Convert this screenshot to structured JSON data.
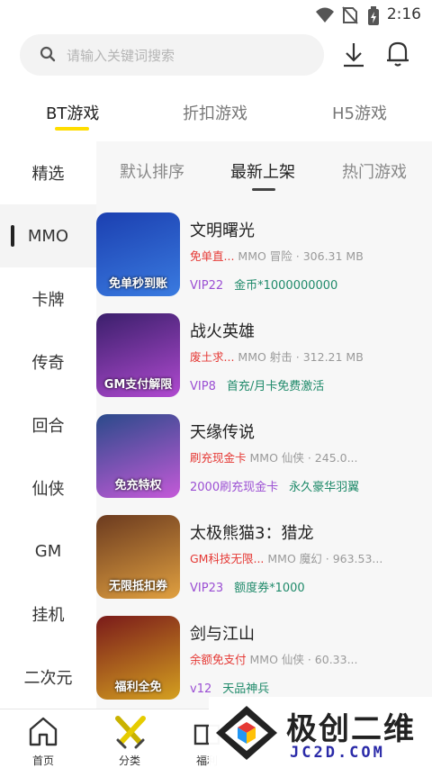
{
  "status_bar": {
    "time": "2:16"
  },
  "search": {
    "placeholder": "请输入关键词搜索"
  },
  "top_tabs": [
    {
      "label": "BT游戏",
      "active": true
    },
    {
      "label": "折扣游戏",
      "active": false
    },
    {
      "label": "H5游戏",
      "active": false
    }
  ],
  "sidebar": [
    {
      "label": "精选"
    },
    {
      "label": "MMO",
      "active": true
    },
    {
      "label": "卡牌"
    },
    {
      "label": "传奇"
    },
    {
      "label": "回合"
    },
    {
      "label": "仙侠"
    },
    {
      "label": "GM"
    },
    {
      "label": "挂机"
    },
    {
      "label": "二次元"
    }
  ],
  "sort_tabs": [
    {
      "label": "默认排序"
    },
    {
      "label": "最新上架",
      "active": true
    },
    {
      "label": "热门游戏"
    }
  ],
  "games": [
    {
      "title": "文明曙光",
      "promo": "免单直...",
      "meta": "MMO 冒险 · 306.31 MB",
      "tag1": "VIP22",
      "tag2": "金币*1000000000",
      "thumb_text": "免单秒到账",
      "colors": [
        "#1b3fb0",
        "#3a7be0"
      ]
    },
    {
      "title": "战火英雄",
      "promo": "废土求...",
      "meta": "MMO 射击 · 312.21 MB",
      "tag1": "VIP8",
      "tag2": "首充/月卡免费激活",
      "thumb_text": "GM支付解限",
      "colors": [
        "#3a1f6b",
        "#b04ad0"
      ]
    },
    {
      "title": "天缘传说",
      "promo": "刷充现金卡",
      "meta": "MMO 仙侠 · 245.0...",
      "tag1": "2000刷充现金卡",
      "tag2": "永久豪华羽翼",
      "thumb_text": "免充特权",
      "colors": [
        "#2a4a8a",
        "#c45ad8"
      ]
    },
    {
      "title": "太极熊猫3：猎龙",
      "promo": "GM科技无限...",
      "meta": "MMO 魔幻 · 963.53...",
      "tag1": "VIP23",
      "tag2": "额度券*1000",
      "thumb_text": "无限抵扣券",
      "colors": [
        "#6b3a1f",
        "#e0a040"
      ]
    },
    {
      "title": "剑与江山",
      "promo": "余额免支付",
      "meta": "MMO 仙侠 · 60.33...",
      "tag1": "v12",
      "tag2": "天品神兵",
      "thumb_text": "福利全免",
      "colors": [
        "#7a1a1a",
        "#d4a020"
      ]
    }
  ],
  "bottom_nav": [
    {
      "label": "首页",
      "icon": "home-icon"
    },
    {
      "label": "分类",
      "icon": "crossed-swords-icon",
      "active": true
    },
    {
      "label": "福利",
      "icon": "gift-icon"
    }
  ],
  "watermark": {
    "text": "极创二维",
    "sub": "JC2D.COM"
  }
}
